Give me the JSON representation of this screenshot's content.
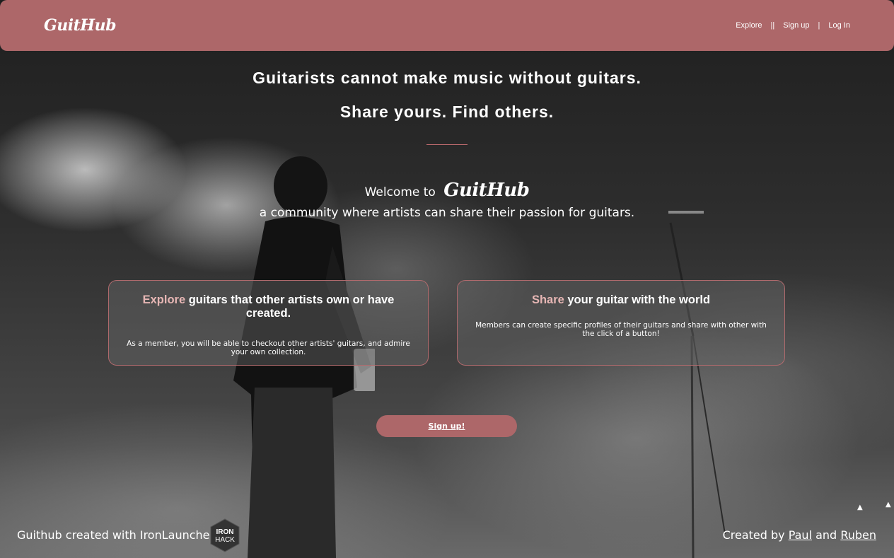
{
  "navbar": {
    "logo": "GuitHub",
    "links": [
      "Explore",
      "Sign up",
      "Log In"
    ],
    "separators": [
      "||",
      "|"
    ]
  },
  "hero": {
    "line1": "Guitarists cannot make music without guitars.",
    "line2": "Share yours. Find others.",
    "welcome_prefix": "Welcome to",
    "welcome_brand": "GuitHub",
    "community": "a community where artists can share their passion for guitars."
  },
  "cards": [
    {
      "accent": "Explore",
      "title_rest": " guitars that other artists own or have created.",
      "text": "As a member, you will be able to checkout other artists' guitars, and admire your own collection."
    },
    {
      "accent": "Share",
      "title_rest": " your guitar with the world",
      "text": "Members can create specific profiles of their guitars and share with other with the click of a button!"
    }
  ],
  "cta": {
    "label": "Sign up!"
  },
  "footer": {
    "left_text": "Guithub created with IronLauncher",
    "badge_line1": "IRON",
    "badge_line2": "HACK",
    "right_prefix": "Created by",
    "author1": "Paul",
    "and": "and",
    "author2": "Ruben"
  },
  "colors": {
    "brand": "#ad6769",
    "accent_text": "#e6b6b4",
    "card_border": "#b06a6d"
  }
}
